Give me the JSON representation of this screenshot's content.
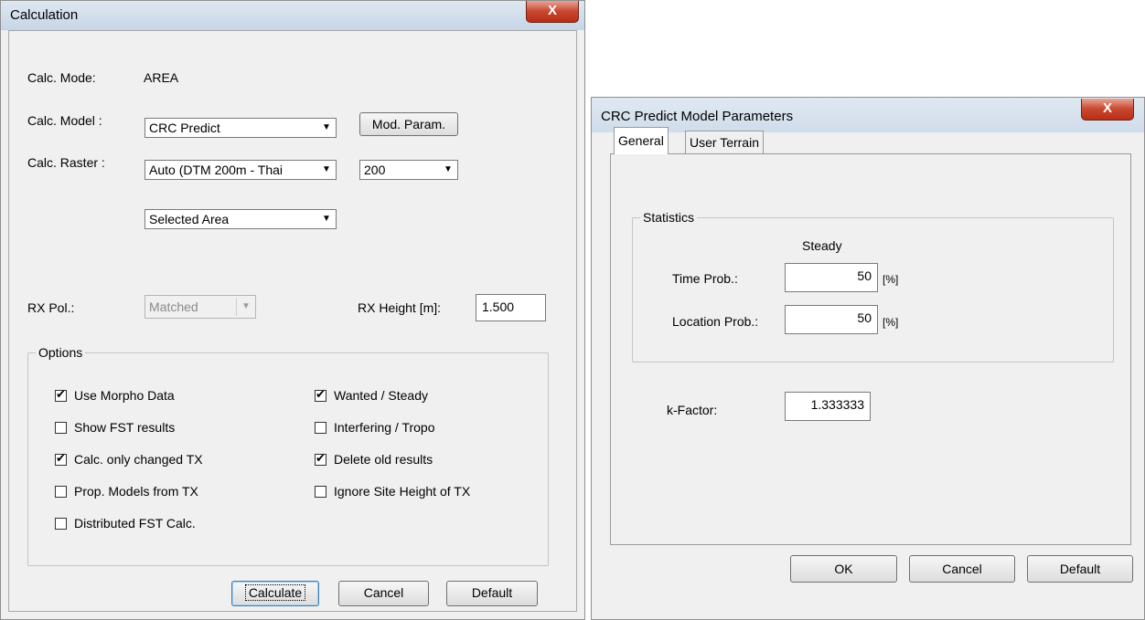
{
  "calc_window": {
    "title": "Calculation",
    "close_glyph": "X",
    "calc_mode_label": "Calc. Mode:",
    "calc_mode_value": "AREA",
    "calc_model_label": "Calc. Model :",
    "calc_model_value": "CRC Predict",
    "mod_param_button": "Mod. Param.",
    "calc_raster_label": "Calc. Raster :",
    "calc_raster_value": "Auto (DTM 200m - Thai",
    "raster_size_value": "200",
    "area_value": "Selected Area",
    "rx_pol_label": "RX Pol.:",
    "rx_pol_value": "Matched",
    "rx_height_label": "RX Height [m]:",
    "rx_height_value": "1.500",
    "options_title": "Options",
    "options": [
      {
        "label": "Use Morpho Data",
        "checked": true
      },
      {
        "label": "Show FST results",
        "checked": false
      },
      {
        "label": "Calc. only changed TX",
        "checked": true
      },
      {
        "label": "Prop. Models from TX",
        "checked": false
      },
      {
        "label": "Distributed FST Calc.",
        "checked": false
      },
      {
        "label": "Wanted / Steady",
        "checked": true
      },
      {
        "label": "Interfering / Tropo",
        "checked": false
      },
      {
        "label": "Delete old results",
        "checked": true
      },
      {
        "label": "Ignore Site Height of TX",
        "checked": false
      }
    ],
    "calculate_button": "Calculate",
    "cancel_button": "Cancel",
    "default_button": "Default"
  },
  "model_window": {
    "title": "CRC Predict Model Parameters",
    "close_glyph": "X",
    "tabs": [
      {
        "label": "General",
        "active": true
      },
      {
        "label": "User Terrain",
        "active": false
      }
    ],
    "statistics_title": "Statistics",
    "steady_header": "Steady",
    "time_prob_label": "Time Prob.:",
    "time_prob_value": "50",
    "time_prob_unit": "[%]",
    "location_prob_label": "Location Prob.:",
    "location_prob_value": "50",
    "location_prob_unit": "[%]",
    "k_factor_label": "k-Factor:",
    "k_factor_value": "1.333333",
    "ok_button": "OK",
    "cancel_button": "Cancel",
    "default_button": "Default"
  },
  "colors": {
    "dialog_bg": "#f0f0f0",
    "close_button_red": "#c9462f",
    "titlebar_blue": "#c6d5e6"
  }
}
